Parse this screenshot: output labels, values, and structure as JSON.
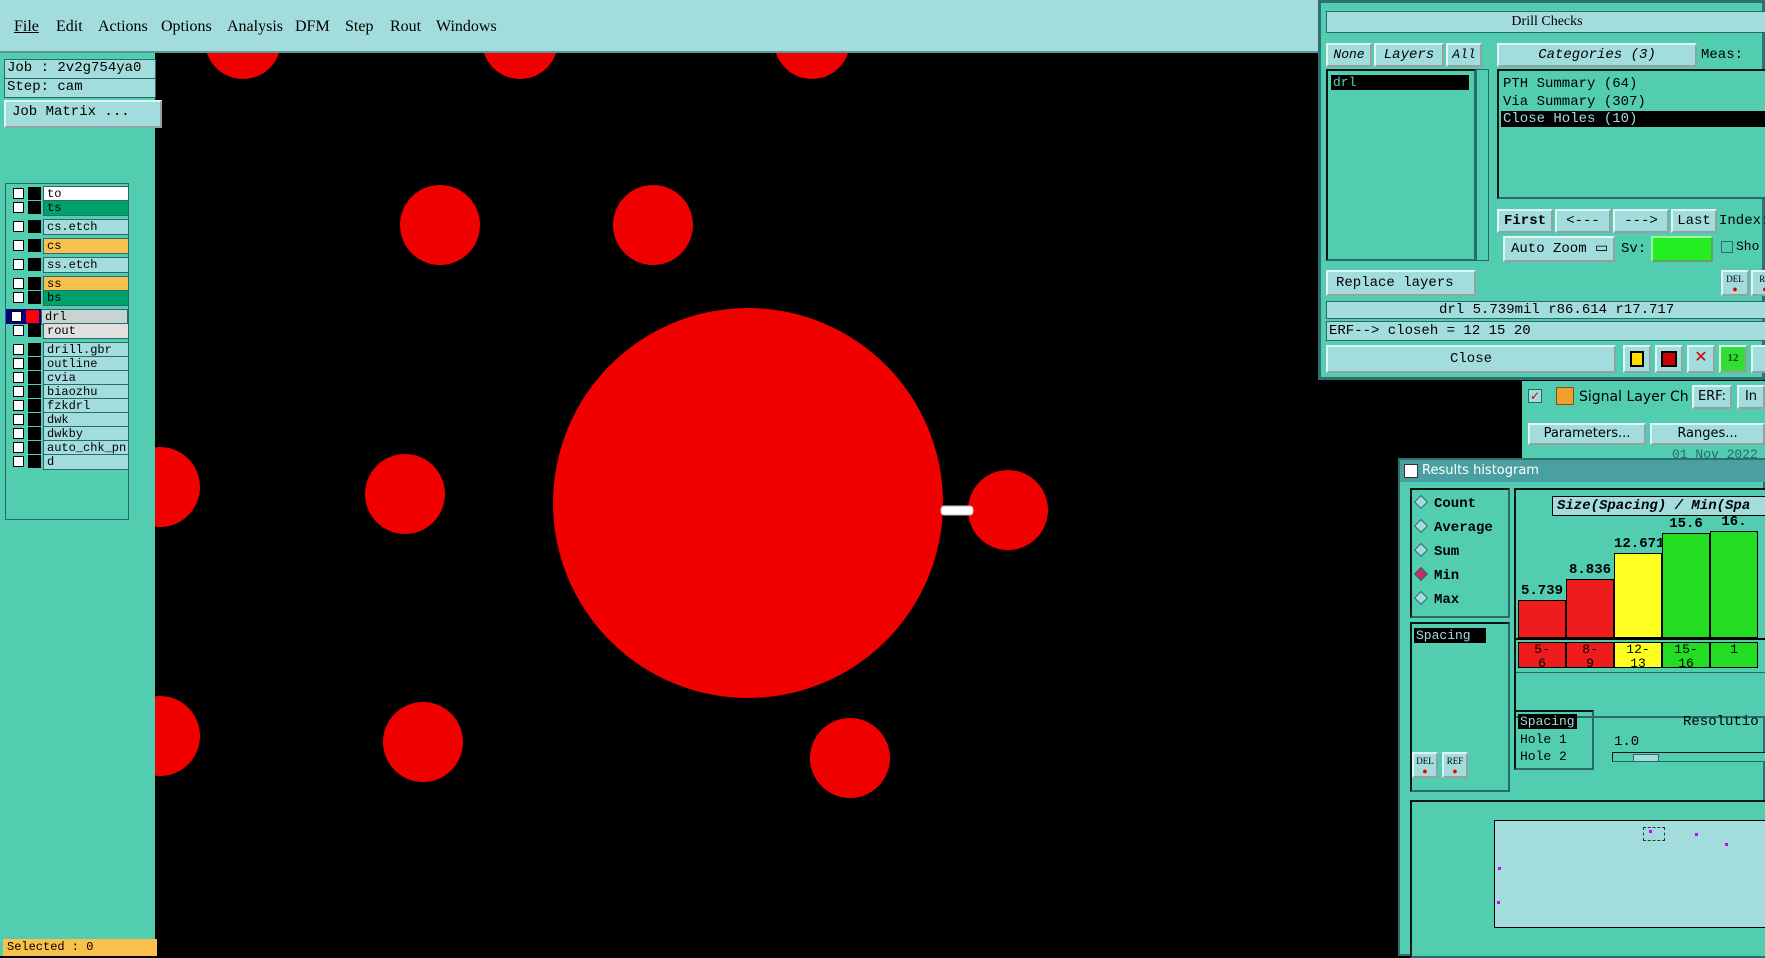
{
  "menu": [
    "File",
    "Edit",
    "Actions",
    "Options",
    "Analysis",
    "DFM",
    "Step",
    "Rout",
    "Windows"
  ],
  "job": "Job : 2v2g754ya0",
  "step": "Step: cam",
  "job_matrix": "Job Matrix ...",
  "layers": [
    {
      "name": "to",
      "color": "#ffffff",
      "swatch": "#000000"
    },
    {
      "name": "ts",
      "color": "#00a06a",
      "swatch": "#000000"
    },
    {
      "name": "cs.etch",
      "color": "#a3dcdc",
      "swatch": "#000000"
    },
    {
      "name": "cs",
      "color": "#f8c04c",
      "swatch": "#000000"
    },
    {
      "name": "ss.etch",
      "color": "#a3dcdc",
      "swatch": "#000000"
    },
    {
      "name": "ss",
      "color": "#f8c04c",
      "swatch": "#000000"
    },
    {
      "name": "bs",
      "color": "#00a06a",
      "swatch": "#000000"
    },
    {
      "name": "drl",
      "color": "#c8d4d4",
      "swatch": "#ff0000",
      "active": true
    },
    {
      "name": "rout",
      "color": "#e0e0e0",
      "swatch": "#000000"
    },
    {
      "name": "drill.gbr",
      "color": "#a3dcdc",
      "swatch": "#000000"
    },
    {
      "name": "outline",
      "color": "#a3dcdc",
      "swatch": "#000000"
    },
    {
      "name": "cvia",
      "color": "#a3dcdc",
      "swatch": "#000000"
    },
    {
      "name": "biaozhu",
      "color": "#a3dcdc",
      "swatch": "#000000"
    },
    {
      "name": "fzkdrl",
      "color": "#a3dcdc",
      "swatch": "#000000"
    },
    {
      "name": "dwk",
      "color": "#a3dcdc",
      "swatch": "#000000"
    },
    {
      "name": "dwkby",
      "color": "#a3dcdc",
      "swatch": "#000000"
    },
    {
      "name": "auto_chk_pn",
      "color": "#a3dcdc",
      "swatch": "#000000"
    },
    {
      "name": "d",
      "color": "#a3dcdc",
      "swatch": "#000000"
    }
  ],
  "selected": "Selected : 0",
  "drill": {
    "title": "Drill Checks",
    "none": "None",
    "layers": "Layers",
    "all": "All",
    "categories": "Categories (3)",
    "meas": "Meas:",
    "layer_item": "drl",
    "category_items": [
      "PTH Summary (64)",
      "Via Summary (307)",
      "Close Holes (10)"
    ],
    "first": "First",
    "prev": "<---",
    "next": "--->",
    "last": "Last",
    "index": "Index:",
    "auto_zoom": "Auto Zoom",
    "sv": "Sv:",
    "show": "Sho",
    "replace_layers": "Replace layers",
    "status": "drl 5.739mil  r86.614  r17.717",
    "erf": "ERF--> closeh = 12 15 20",
    "close": "Close",
    "del": "DEL",
    "ref": "RE"
  },
  "signal": {
    "title": "Signal Layer Ch",
    "erf": "ERF:",
    "in": "In",
    "params": "Parameters...",
    "ranges": "Ranges...",
    "date": "01 Nov 2022"
  },
  "histogram": {
    "title": "Results histogram",
    "modes": [
      "Count",
      "Average",
      "Sum",
      "Min",
      "Max"
    ],
    "selected_mode": "Min",
    "chart_title": "Size(Spacing) / Min(Spa",
    "list_item": "Spacing",
    "legend": [
      "Spacing",
      "Hole 1",
      "Hole 2"
    ],
    "resolution": "Resolutio",
    "res_value": "1.0",
    "del": "DEL",
    "ref": "REF"
  },
  "chart_data": {
    "type": "bar",
    "title": "Size(Spacing) / Min(Spa",
    "categories": [
      "5-6",
      "8-9",
      "12-13",
      "15-16",
      "1"
    ],
    "values": [
      5.739,
      8.836,
      12.671,
      15.6,
      16.0
    ],
    "value_labels": [
      "5.739",
      "8.836",
      "12.671",
      "15.6",
      "16."
    ],
    "colors": [
      "#ee1c1c",
      "#ee1c1c",
      "#ffff22",
      "#22dd22",
      "#22dd22"
    ],
    "range_labels": [
      [
        "5-",
        "6"
      ],
      [
        "8-",
        "9"
      ],
      [
        "12-",
        "13"
      ],
      [
        "15-",
        "16"
      ],
      [
        "1",
        ""
      ]
    ],
    "ylim": [
      0,
      17
    ],
    "grid": false
  }
}
